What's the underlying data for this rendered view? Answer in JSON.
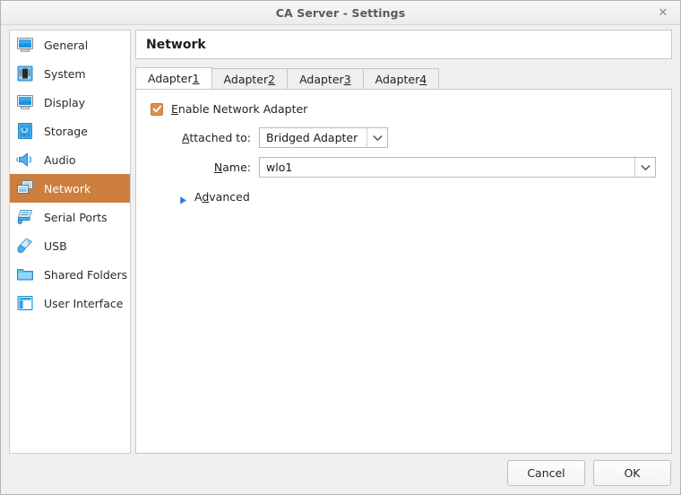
{
  "window": {
    "title": "CA Server - Settings",
    "close_label": "✕"
  },
  "sidebar": {
    "items": [
      {
        "label": "General",
        "icon": "monitor-icon",
        "selected": false
      },
      {
        "label": "System",
        "icon": "chip-icon",
        "selected": false
      },
      {
        "label": "Display",
        "icon": "display-icon",
        "selected": false
      },
      {
        "label": "Storage",
        "icon": "harddisk-icon",
        "selected": false
      },
      {
        "label": "Audio",
        "icon": "speaker-icon",
        "selected": false
      },
      {
        "label": "Network",
        "icon": "network-cards-icon",
        "selected": true
      },
      {
        "label": "Serial Ports",
        "icon": "serial-port-icon",
        "selected": false
      },
      {
        "label": "USB",
        "icon": "usb-icon",
        "selected": false
      },
      {
        "label": "Shared Folders",
        "icon": "folder-icon",
        "selected": false
      },
      {
        "label": "User Interface",
        "icon": "window-icon",
        "selected": false
      }
    ]
  },
  "pane": {
    "header_title": "Network",
    "tabs": [
      {
        "prefix": "Adapter ",
        "mnemonic": "1",
        "active": true
      },
      {
        "prefix": "Adapter ",
        "mnemonic": "2",
        "active": false
      },
      {
        "prefix": "Adapter ",
        "mnemonic": "3",
        "active": false
      },
      {
        "prefix": "Adapter ",
        "mnemonic": "4",
        "active": false
      }
    ],
    "form": {
      "enable_adapter": {
        "checked": true,
        "label_mnemonic": "E",
        "label_rest": "nable Network Adapter"
      },
      "attached_to": {
        "label_mnemonic": "A",
        "label_rest": "ttached to:",
        "value": "Bridged Adapter"
      },
      "name": {
        "label_mnemonic": "N",
        "label_rest": "ame:",
        "value": "wlo1"
      },
      "advanced": {
        "label_pre": "A",
        "label_mnemonic": "d",
        "label_post": "vanced",
        "expanded": false
      }
    }
  },
  "footer": {
    "cancel_label": "Cancel",
    "ok_label": "OK"
  },
  "colors": {
    "selection": "#cc7f3f",
    "checkbox": "#d9914d",
    "icon_blue": "#1e8fe0",
    "triangle_blue": "#2d7fd4"
  }
}
